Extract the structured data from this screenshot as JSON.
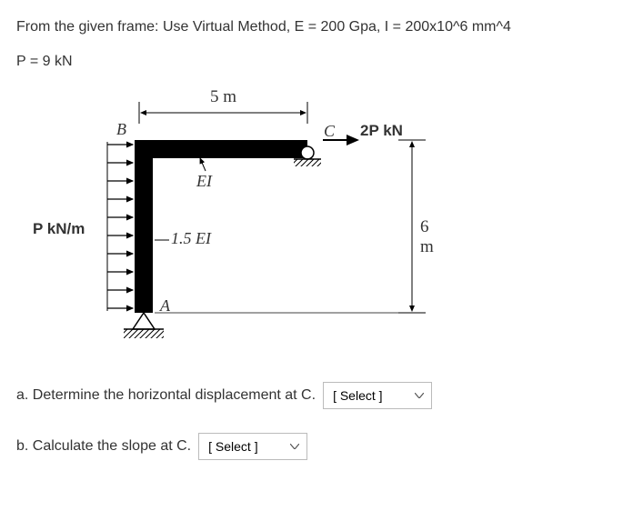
{
  "problem": {
    "line1": "From the given frame: Use Virtual Method, E = 200 Gpa, I = 200x10^6 mm^4",
    "line2": "P = 9 kN"
  },
  "diagram": {
    "dim_top": "5 m",
    "dim_right": "6 m",
    "load_left": "P kN/m",
    "load_right": "2P kN",
    "ei_top": "EI",
    "ei_left": "1.5 EI",
    "node_a": "A",
    "node_b": "B",
    "node_c": "C"
  },
  "questions": {
    "a_text": "a. Determine the horizontal displacement at C.",
    "b_text": "b. Calculate the slope at C.",
    "select_placeholder": "[ Select ]"
  }
}
